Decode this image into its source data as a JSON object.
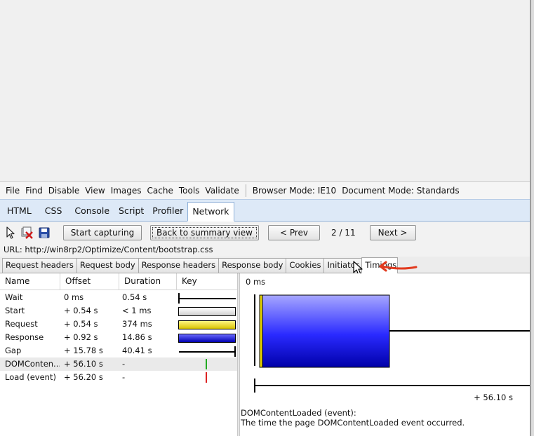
{
  "menubar": {
    "items": [
      "File",
      "Find",
      "Disable",
      "View",
      "Images",
      "Cache",
      "Tools",
      "Validate"
    ],
    "browser_mode_label": "Browser Mode:",
    "browser_mode_value": "IE10",
    "document_mode_label": "Document Mode:",
    "document_mode_value": "Standards"
  },
  "tabs": {
    "items": [
      "HTML",
      "CSS",
      "Console",
      "Script",
      "Profiler",
      "Network"
    ],
    "active": "Network"
  },
  "toolbar": {
    "icons": [
      "select-element-icon",
      "clear-cache-icon",
      "save-icon"
    ],
    "start_capturing": "Start capturing",
    "back_to_summary": "Back to summary view",
    "prev": "< Prev",
    "counter": "2 / 11",
    "next": "Next >"
  },
  "url_line": "URL: http://win8rp2/Optimize/Content/bootstrap.css",
  "subtabs": {
    "items": [
      "Request headers",
      "Request body",
      "Response headers",
      "Response body",
      "Cookies",
      "Initiator",
      "Timings"
    ],
    "active": "Timings"
  },
  "timings_table": {
    "columns": [
      "Name",
      "Offset",
      "Duration",
      "Key"
    ],
    "rows": [
      {
        "name": "Wait",
        "offset": "0 ms",
        "duration": "0.54 s",
        "key": "wait"
      },
      {
        "name": "Start",
        "offset": "+ 0.54 s",
        "duration": "< 1 ms",
        "key": "start"
      },
      {
        "name": "Request",
        "offset": "+ 0.54 s",
        "duration": "374 ms",
        "key": "request"
      },
      {
        "name": "Response",
        "offset": "+ 0.92 s",
        "duration": "14.86 s",
        "key": "response"
      },
      {
        "name": "Gap",
        "offset": "+ 15.78 s",
        "duration": "40.41 s",
        "key": "gap"
      },
      {
        "name": "DOMConten...",
        "offset": "+ 56.10 s",
        "duration": "-",
        "key": "domcontentloaded"
      },
      {
        "name": "Load (event)",
        "offset": "+ 56.20 s",
        "duration": "-",
        "key": "load"
      }
    ],
    "highlighted_row": 5
  },
  "timeline": {
    "start_label": "0 ms",
    "end_label": "+ 56.10 s",
    "colors": {
      "request": "#e8d600",
      "response_top": "#a7a7ff",
      "response_bottom": "#0000a8",
      "dom_marker": "#22aa22",
      "load_marker": "#dd2222",
      "annotation_arrow": "#e23a1e"
    }
  },
  "footnote": {
    "title": "DOMContentLoaded (event):",
    "text": "The time the page DOMContentLoaded event occurred."
  }
}
